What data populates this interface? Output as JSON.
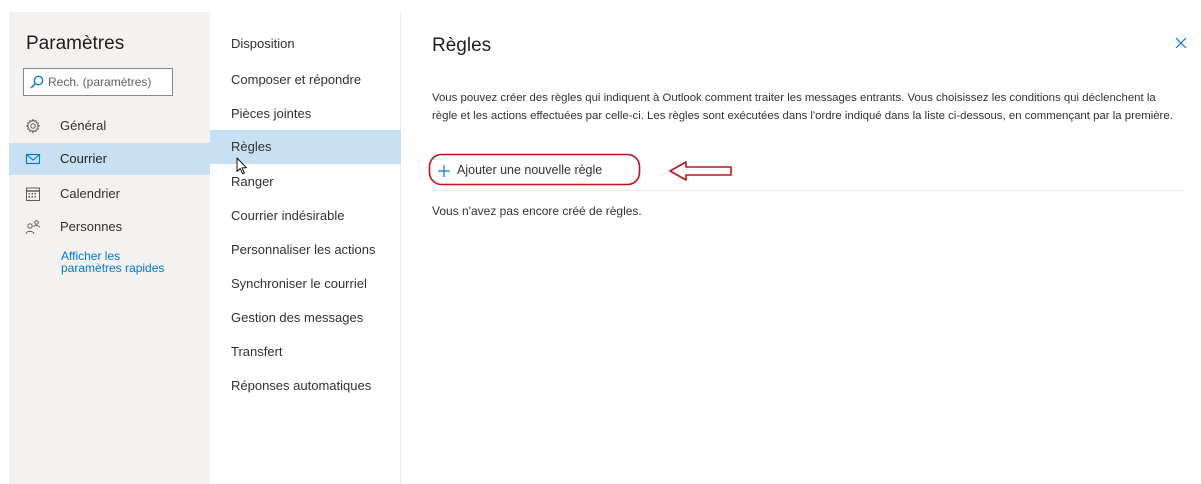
{
  "settings": {
    "title": "Paramètres",
    "search_placeholder": "Rech. (paramètres)",
    "nav": [
      {
        "label": "Général",
        "icon": "gear-icon"
      },
      {
        "label": "Courrier",
        "icon": "mail-icon"
      },
      {
        "label": "Calendrier",
        "icon": "calendar-icon"
      },
      {
        "label": "Personnes",
        "icon": "people-icon"
      }
    ],
    "quick_settings_line1": "Afficher les",
    "quick_settings_line2": "paramètres rapides"
  },
  "categories": [
    "Disposition",
    "Composer et répondre",
    "Pièces jointes",
    "Règles",
    "Ranger",
    "Courrier indésirable",
    "Personnaliser les actions",
    "Synchroniser le courriel",
    "Gestion des messages",
    "Transfert",
    "Réponses automatiques"
  ],
  "content": {
    "title": "Règles",
    "description": "Vous pouvez créer des règles qui indiquent à Outlook comment traiter les messages entrants. Vous choisissez les conditions qui déclenchent la règle et les actions effectuées par celle-ci. Les règles sont exécutées dans l'ordre indiqué dans la liste ci-dessous, en commençant par la première.",
    "add_rule_label": "Ajouter une nouvelle règle",
    "empty_message": "Vous n'avez pas encore créé de règles."
  },
  "colors": {
    "accent": "#0078d4",
    "selected_bg": "#c7e0f4",
    "annotation_red": "#c50f1f"
  }
}
